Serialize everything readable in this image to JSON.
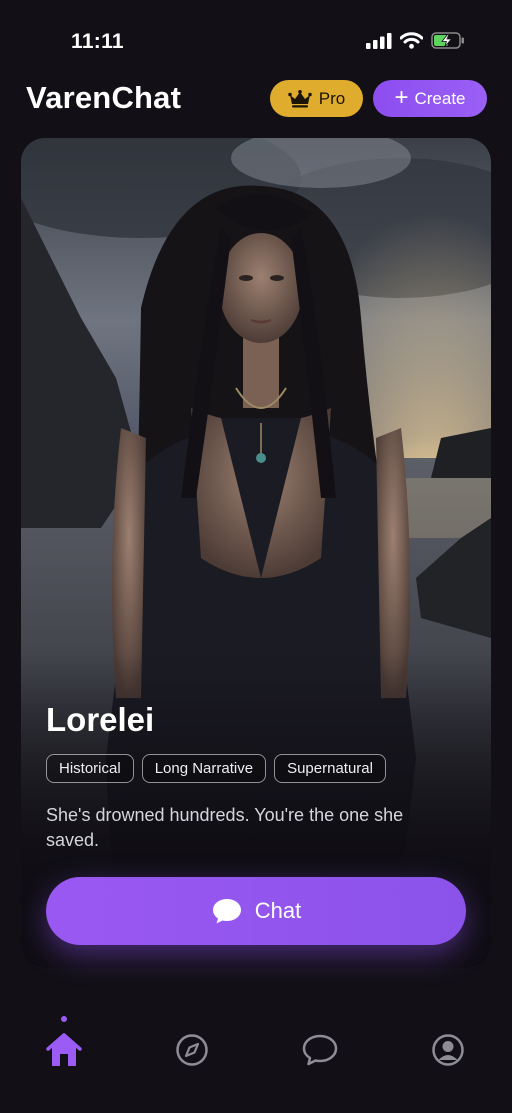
{
  "status_bar": {
    "time": "11:11",
    "battery_state": "charging"
  },
  "header": {
    "app_title": "VarenChat",
    "pro_label": "Pro",
    "create_label": "Create"
  },
  "character": {
    "name": "Lorelei",
    "tags": [
      "Historical",
      "Long Narrative",
      "Supernatural"
    ],
    "tagline": "She's drowned hundreds. You're the one she saved.",
    "photo_description_icon": "portrait-photo"
  },
  "chat_button": {
    "label": "Chat",
    "icon": "chat-bubble-icon"
  },
  "bottom_nav": {
    "items": [
      {
        "name": "home",
        "icon": "home-icon",
        "active": true
      },
      {
        "name": "explore",
        "icon": "compass-icon",
        "active": false
      },
      {
        "name": "chats",
        "icon": "chat-icon",
        "active": false
      },
      {
        "name": "profile",
        "icon": "profile-icon",
        "active": false
      }
    ]
  },
  "colors": {
    "background": "#121016",
    "accent": "#9b5cf6",
    "pro_gold": "#e0ac2e",
    "inactive_icon": "#8e8c96"
  }
}
